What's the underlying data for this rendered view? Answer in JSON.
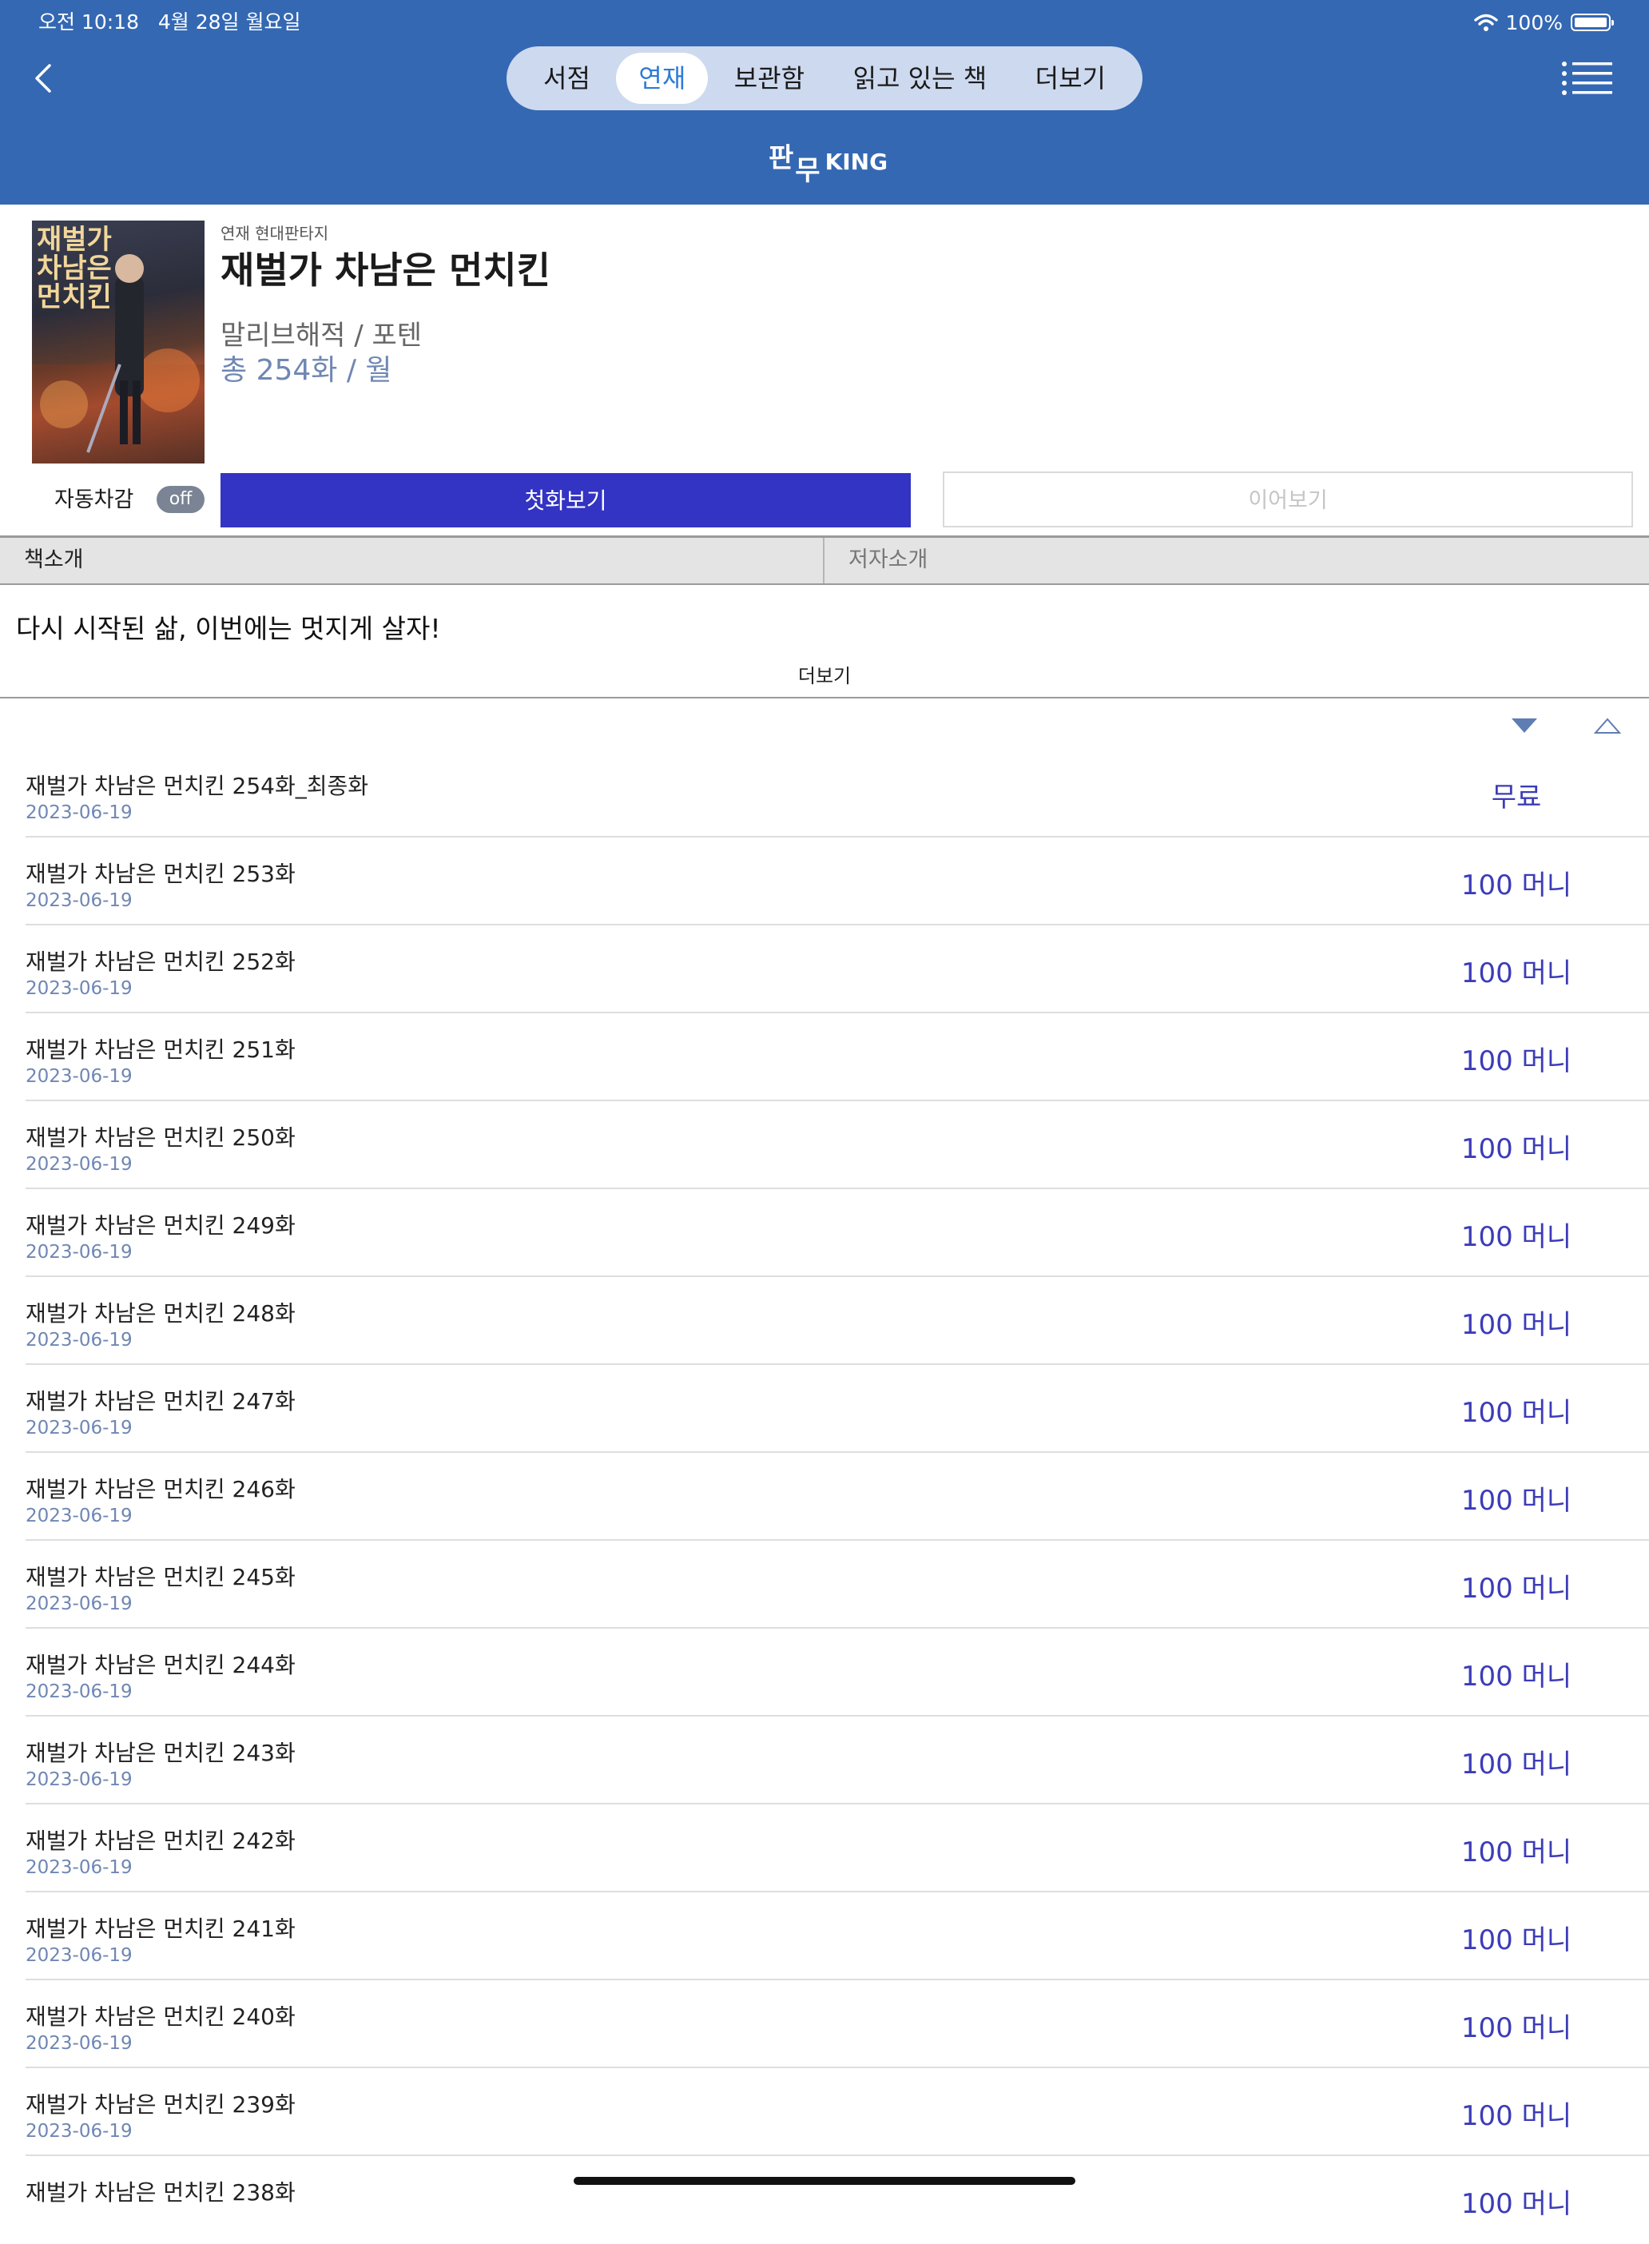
{
  "status_bar": {
    "time": "오전 10:18",
    "date": "4월 28일 월요일",
    "battery": "100%"
  },
  "nav": {
    "tabs": [
      {
        "label": "서점",
        "active": false
      },
      {
        "label": "연재",
        "active": true
      },
      {
        "label": "보관함",
        "active": false
      },
      {
        "label": "읽고 있는 책",
        "active": false
      },
      {
        "label": "더보기",
        "active": false
      }
    ],
    "logo_k1": "판",
    "logo_k2": "무",
    "logo_en": "KING"
  },
  "book": {
    "genre": "연재 현대판타지",
    "title": "재벌가 차남은 먼치킨",
    "author": "말리브해적 / 포텐",
    "count": "총 254화 / 월",
    "cover_text": "재벌가 차남은 먼치킨"
  },
  "actions": {
    "auto_label": "자동차감",
    "auto_state": "off",
    "first_label": "첫화보기",
    "continue_label": "이어보기"
  },
  "info_tabs": {
    "book_intro": "책소개",
    "author_intro": "저자소개"
  },
  "description": "다시 시작된 삶, 이번에는 멋지게 살자!",
  "more_label": "더보기",
  "episodes": [
    {
      "title": "재벌가 차남은 먼치킨 254화_최종화",
      "date": "2023-06-19",
      "price": "무료"
    },
    {
      "title": "재벌가 차남은 먼치킨 253화",
      "date": "2023-06-19",
      "price": "100 머니"
    },
    {
      "title": "재벌가 차남은 먼치킨 252화",
      "date": "2023-06-19",
      "price": "100 머니"
    },
    {
      "title": "재벌가 차남은 먼치킨 251화",
      "date": "2023-06-19",
      "price": "100 머니"
    },
    {
      "title": "재벌가 차남은 먼치킨 250화",
      "date": "2023-06-19",
      "price": "100 머니"
    },
    {
      "title": "재벌가 차남은 먼치킨 249화",
      "date": "2023-06-19",
      "price": "100 머니"
    },
    {
      "title": "재벌가 차남은 먼치킨 248화",
      "date": "2023-06-19",
      "price": "100 머니"
    },
    {
      "title": "재벌가 차남은 먼치킨 247화",
      "date": "2023-06-19",
      "price": "100 머니"
    },
    {
      "title": "재벌가 차남은 먼치킨 246화",
      "date": "2023-06-19",
      "price": "100 머니"
    },
    {
      "title": "재벌가 차남은 먼치킨 245화",
      "date": "2023-06-19",
      "price": "100 머니"
    },
    {
      "title": "재벌가 차남은 먼치킨 244화",
      "date": "2023-06-19",
      "price": "100 머니"
    },
    {
      "title": "재벌가 차남은 먼치킨 243화",
      "date": "2023-06-19",
      "price": "100 머니"
    },
    {
      "title": "재벌가 차남은 먼치킨 242화",
      "date": "2023-06-19",
      "price": "100 머니"
    },
    {
      "title": "재벌가 차남은 먼치킨 241화",
      "date": "2023-06-19",
      "price": "100 머니"
    },
    {
      "title": "재벌가 차남은 먼치킨 240화",
      "date": "2023-06-19",
      "price": "100 머니"
    },
    {
      "title": "재벌가 차남은 먼치킨 239화",
      "date": "2023-06-19",
      "price": "100 머니"
    },
    {
      "title": "재벌가 차남은 먼치킨 238화",
      "date": "",
      "price": "100 머니"
    }
  ],
  "icons": {
    "back": "chevron-left-icon",
    "menu": "list-icon",
    "wifi": "wifi-icon",
    "battery": "battery-icon",
    "sort_desc": "triangle-down-filled-icon",
    "sort_asc": "triangle-up-outline-icon"
  },
  "colors": {
    "header": "#3468b3",
    "primary_button": "#3333c4",
    "price": "#3c3cb8",
    "date": "#6f87b3",
    "active_tab": "#2f7bd6"
  }
}
